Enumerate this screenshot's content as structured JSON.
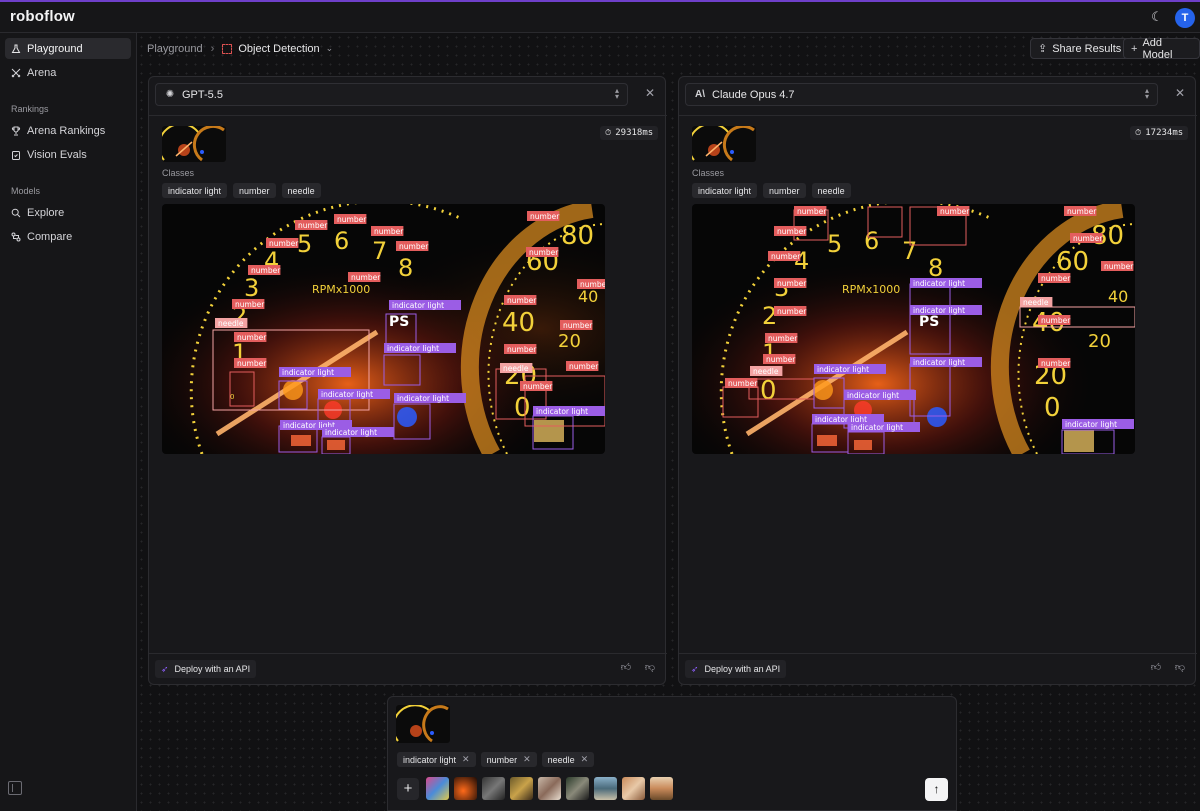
{
  "app": {
    "logo": "roboflow",
    "avatar_initial": "T"
  },
  "sidebar": {
    "items": [
      {
        "label": "Playground",
        "icon": "flask-icon",
        "active": true
      },
      {
        "label": "Arena",
        "icon": "swords-icon",
        "active": false
      }
    ],
    "rankings_section": "Rankings",
    "rankings_items": [
      {
        "label": "Arena Rankings",
        "icon": "trophy-icon"
      },
      {
        "label": "Vision Evals",
        "icon": "clipboard-icon"
      }
    ],
    "models_section": "Models",
    "models_items": [
      {
        "label": "Explore",
        "icon": "search-icon"
      },
      {
        "label": "Compare",
        "icon": "compare-icon"
      }
    ]
  },
  "header": {
    "breadcrumb_root": "Playground",
    "breadcrumb_current": "Object Detection",
    "share_label": "Share Results",
    "add_model_label": "Add Model"
  },
  "panels": [
    {
      "model": "GPT-5.5",
      "timer": "29318ms",
      "classes_label": "Classes",
      "classes": [
        "indicator light",
        "number",
        "needle"
      ],
      "deploy_label": "Deploy with an API"
    },
    {
      "model": "Claude Opus 4.7",
      "timer": "17234ms",
      "classes_label": "Classes",
      "classes": [
        "indicator light",
        "number",
        "needle"
      ],
      "deploy_label": "Deploy with an API"
    }
  ],
  "overlay_labels": {
    "number": "number",
    "indicator": "indicator light",
    "needle": "needle",
    "rpm": "RPMx1000",
    "ps": "PS"
  },
  "composer": {
    "classes": [
      "indicator light",
      "number",
      "needle"
    ]
  },
  "colors": {
    "accent": "#6e3fc9",
    "number_box": "#e35d5d",
    "indicator_box": "#9b5de5",
    "needle_box": "#f4a3a3"
  }
}
